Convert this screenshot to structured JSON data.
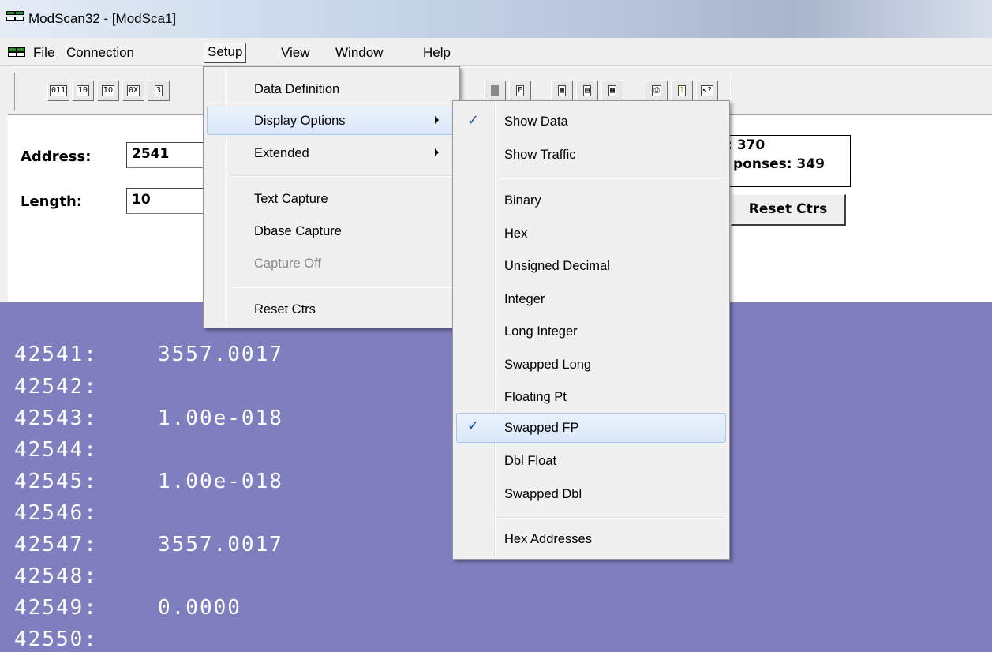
{
  "window": {
    "title": "ModScan32 - [ModSca1]"
  },
  "menubar": {
    "file": "File",
    "connection": "Connection",
    "setup": "Setup",
    "view": "View",
    "window": "Window",
    "help": "Help"
  },
  "toolbar": {
    "icons": [
      "coil-status-icon",
      "input-status-icon",
      "holding-register-icon",
      "hex-icon",
      "input-register-icon",
      "disconnect-icon",
      "function-icon",
      "tile-icon",
      "display-icon",
      "traffic-icon",
      "print-icon",
      "help-icon",
      "context-help-icon"
    ]
  },
  "form": {
    "address_label": "Address:",
    "address_value": "2541",
    "length_label": "Length:",
    "length_value": "10",
    "polls_text": ": 370",
    "responses_text": "ponses: 349",
    "reset_button": "Reset Ctrs"
  },
  "setup_menu": {
    "items": [
      "Data Definition",
      "Display Options",
      "Extended",
      "Text Capture",
      "Dbase Capture",
      "Capture Off",
      "Reset Ctrs"
    ]
  },
  "display_menu": {
    "items": [
      "Show Data",
      "Show Traffic",
      "Binary",
      "Hex",
      "Unsigned Decimal",
      "Integer",
      "Long Integer",
      "Swapped Long",
      "Floating Pt",
      "Swapped FP",
      "Dbl Float",
      "Swapped Dbl",
      "Hex Addresses"
    ],
    "checked": [
      "Show Data",
      "Swapped FP"
    ],
    "check_glyph": "✓"
  },
  "data_rows": [
    {
      "addr": "42541:",
      "value": "3557.0017"
    },
    {
      "addr": "42542:",
      "value": ""
    },
    {
      "addr": "42543:",
      "value": "1.00e-018"
    },
    {
      "addr": "42544:",
      "value": ""
    },
    {
      "addr": "42545:",
      "value": "1.00e-018"
    },
    {
      "addr": "42546:",
      "value": ""
    },
    {
      "addr": "42547:",
      "value": "3557.0017"
    },
    {
      "addr": "42548:",
      "value": ""
    },
    {
      "addr": "42549:",
      "value": "0.0000"
    },
    {
      "addr": "42550:",
      "value": ""
    }
  ],
  "colors": {
    "data_bg": "#7f7fbf",
    "data_text": "#ffffff",
    "check": "#1f4e9c"
  }
}
